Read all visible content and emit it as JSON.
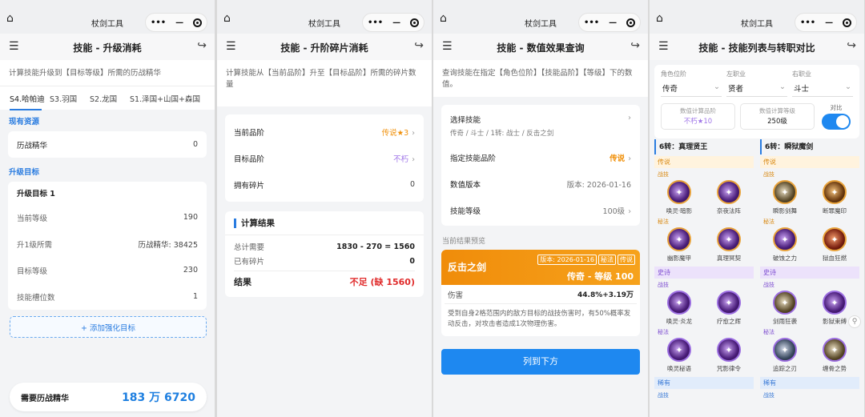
{
  "app_title": "杖剑工具",
  "p1": {
    "title": "技能 - 升级消耗",
    "desc": "计算技能升级到【目标等级】所需的历战精华",
    "tabs": [
      "S4.哈帕迪",
      "S3.羽国",
      "S2.龙国",
      "S1.泽国+山国+森国"
    ],
    "resources_header": "现有资源",
    "essence_label": "历战精华",
    "essence_value": "0",
    "target_header": "升级目标",
    "target_title": "升级目标 1",
    "current_level_label": "当前等级",
    "current_level_value": "190",
    "cost_label": "升1级所需",
    "cost_value": "历战精华: 38425",
    "target_level_label": "目标等级",
    "target_level_value": "230",
    "slot_label": "技能槽位数",
    "slot_value": "1",
    "add_button": "+ 添加强化目标",
    "need_label": "需要历战精华",
    "need_value": "183 万 6720"
  },
  "p2": {
    "title": "技能 - 升阶碎片消耗",
    "desc": "计算技能从【当前品阶】升至【目标品阶】所需的碎片数量",
    "cur_label": "当前品阶",
    "cur_value": "传说★3",
    "tgt_label": "目标品阶",
    "tgt_value": "不朽",
    "own_label": "拥有碎片",
    "own_value": "0",
    "result_title": "计算结果",
    "total_label": "总计需要",
    "total_value": "1830 - 270 = 1560",
    "have_label": "已有碎片",
    "have_value": "0",
    "final_label": "结果",
    "final_value": "不足 (缺 1560)"
  },
  "p3": {
    "title": "技能 - 数值效果查询",
    "desc": "查询技能在指定【角色位阶】【技能品阶】【等级】下的数值。",
    "select_label": "选择技能",
    "select_value": "传奇 / 斗士 / 1转: 战士 / 反击之剑",
    "grade_label": "指定技能品阶",
    "grade_value": "传说",
    "version_label": "数值版本",
    "version_value": "版本: 2026-01-16",
    "level_label": "技能等级",
    "level_value": "100级",
    "preview_label": "当前结果预览",
    "skill_name": "反击之剑",
    "chips": [
      "版本: 2026-01-16",
      "秘法",
      "传说"
    ],
    "skill_grade": "传奇 - 等级 100",
    "dmg_label": "伤害",
    "dmg_value": "44.8%+3.19万",
    "skill_desc": "受到自身2格范围内的敌方目标的战技伤害时，有50%概率发动反击，对攻击者造成1次物理伤害。",
    "list_button": "列到下方"
  },
  "p4": {
    "title": "技能 - 技能列表与转职对比",
    "sel_labels": [
      "角色位阶",
      "左职业",
      "右职业"
    ],
    "sel_values": [
      "传奇",
      "贤者",
      "斗士"
    ],
    "calc_grade_label": "数值计算品阶",
    "calc_grade_value": "不朽★10",
    "calc_level_label": "数值计算等级",
    "calc_level_value": "250级",
    "compare_label": "对比",
    "left": {
      "title": "6转：真理贤王",
      "g1": "传说",
      "g1_c1": "战技",
      "g1_c1_skills": [
        "唤灵·暗影",
        "奈夜法阵"
      ],
      "g1_c2": "秘法",
      "g1_c2_skills": [
        "幽影魔甲",
        "真理冥契"
      ],
      "g2": "史诗",
      "g2_c1": "战技",
      "g2_c1_skills": [
        "唤灵·炎龙",
        "疗愈之辉"
      ],
      "g2_c2": "秘法",
      "g2_c2_skills": [
        "唤灵秘语",
        "咒影律令"
      ],
      "g3": "稀有",
      "g3_c1": "战技"
    },
    "right": {
      "title": "6转：瞬狱魔剑",
      "g1": "传说",
      "g1_c1": "战技",
      "g1_c1_skills": [
        "瞬影剑舞",
        "断罪魔印"
      ],
      "g1_c2": "秘法",
      "g1_c2_skills": [
        "破蚀之力",
        "狱血狂燃"
      ],
      "g2": "史诗",
      "g2_c1": "战技",
      "g2_c1_skills": [
        "剑雨狂袭",
        "影狱束缚"
      ],
      "g2_c2": "秘法",
      "g2_c2_skills": [
        "追踪之刃",
        "缠骨之势"
      ],
      "g3": "稀有",
      "g3_c1": "战技"
    }
  }
}
